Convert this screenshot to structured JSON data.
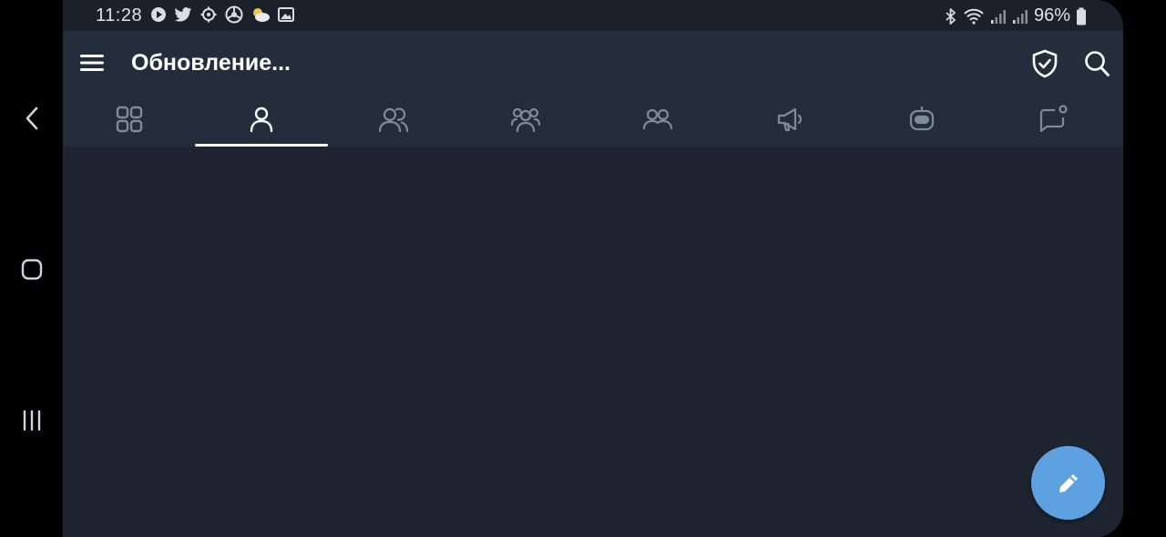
{
  "status_bar": {
    "time": "11:28",
    "battery": "96%",
    "left_icons": [
      "play-icon",
      "twitter-icon",
      "settings-icon",
      "vpn-icon",
      "weather-icon",
      "gallery-icon"
    ],
    "right_icons": [
      "bluetooth-icon",
      "wifi-icon",
      "signal-icon",
      "signal-icon",
      "battery-icon"
    ]
  },
  "app_bar": {
    "title": "Обновление...",
    "actions": [
      "shield-check-icon",
      "search-icon"
    ]
  },
  "tabs": [
    {
      "icon": "all-chats-icon",
      "selected": false
    },
    {
      "icon": "user-icon",
      "selected": true
    },
    {
      "icon": "group-two-icon",
      "selected": false
    },
    {
      "icon": "group-three-icon",
      "selected": false
    },
    {
      "icon": "group-three-icon",
      "selected": false
    },
    {
      "icon": "channel-icon",
      "selected": false
    },
    {
      "icon": "bot-icon",
      "selected": false
    },
    {
      "icon": "unread-chat-icon",
      "selected": false
    }
  ],
  "fab": {
    "icon": "pencil-icon"
  },
  "colors": {
    "background": "#1e2531",
    "appbar": "#232d3b",
    "accent": "#5ea1e1",
    "tab_icon": "#7f8b99"
  }
}
